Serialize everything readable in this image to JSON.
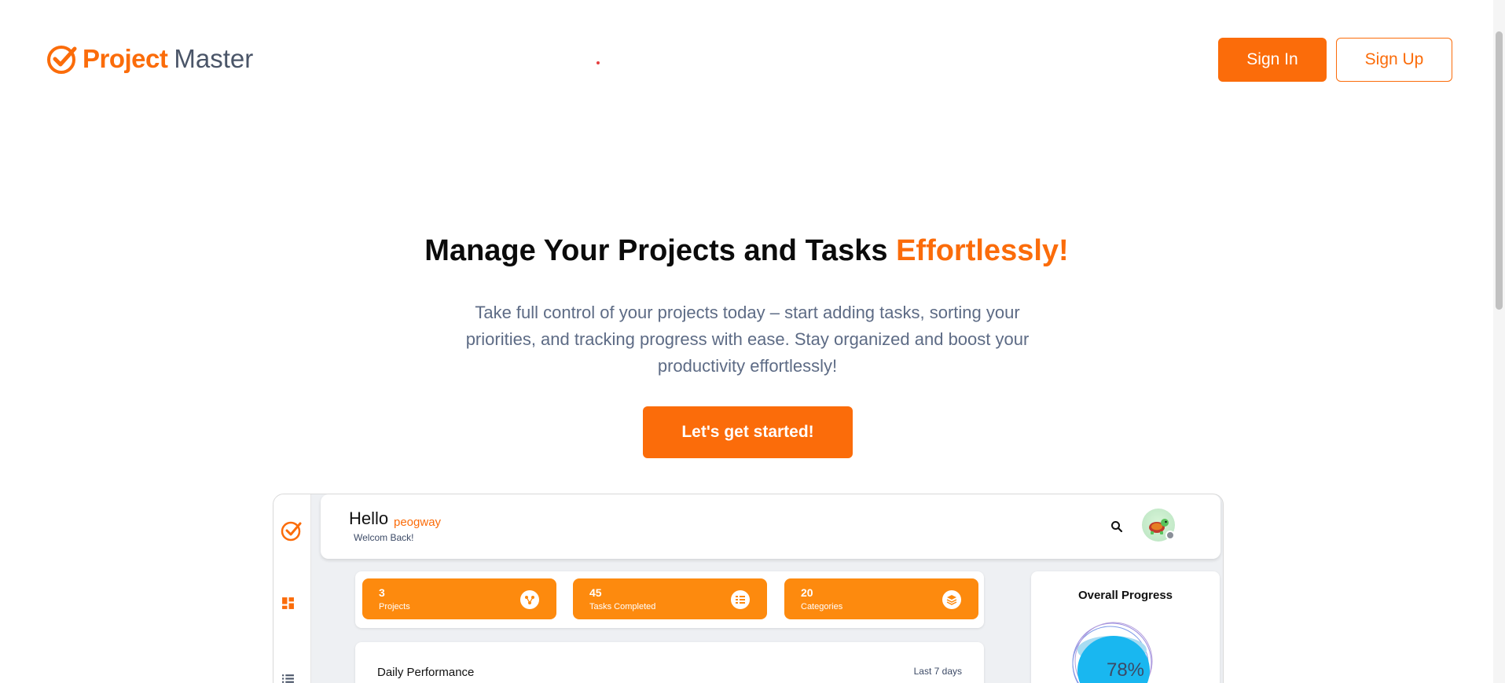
{
  "brand": {
    "name_strong": "Project",
    "name_light": "Master",
    "color": "#fb6c0a"
  },
  "nav": {
    "signin_label": "Sign In",
    "signup_label": "Sign Up"
  },
  "hero": {
    "title_main": "Manage Your Projects and Tasks ",
    "title_accent": "Effortlessly!",
    "subtitle": "Take full control of your projects today – start adding tasks, sorting your priorities, and tracking progress with ease. Stay organized and boost your productivity effortlessly!",
    "cta_label": "Let's get started!"
  },
  "preview": {
    "greeting": "Hello",
    "username": "peogway",
    "welcome": "Welcom Back!",
    "stats": [
      {
        "value": "3",
        "label": "Projects",
        "icon": "share-icon"
      },
      {
        "value": "45",
        "label": "Tasks Completed",
        "icon": "checklist-icon"
      },
      {
        "value": "20",
        "label": "Categories",
        "icon": "layers-icon"
      }
    ],
    "daily": {
      "title": "Daily Performance",
      "range": "Last 7 days"
    },
    "progress": {
      "title": "Overall Progress",
      "value": "78%"
    }
  }
}
